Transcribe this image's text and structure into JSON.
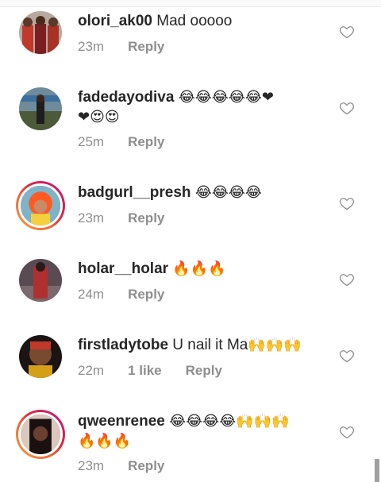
{
  "comments": [
    {
      "username": "olori_ak00",
      "text": " Mad ooooo",
      "emoji": "",
      "emoji2": "",
      "time": "23m",
      "likes": "",
      "reply": "Reply"
    },
    {
      "username": "fadedayodiva",
      "text": " ",
      "emoji": "😂😂😂😂😂❤",
      "emoji2": "❤😍😍",
      "time": "25m",
      "likes": "",
      "reply": "Reply"
    },
    {
      "username": "badgurl__presh",
      "text": " ",
      "emoji": "😂😂😂😂",
      "emoji2": "",
      "time": "23m",
      "likes": "",
      "reply": "Reply"
    },
    {
      "username": "holar__holar",
      "text": " ",
      "emoji": "🔥🔥🔥",
      "emoji2": "",
      "time": "24m",
      "likes": "",
      "reply": "Reply"
    },
    {
      "username": "firstladytobe",
      "text": " U nail it Ma",
      "emoji": "🙌🙌🙌",
      "emoji2": "",
      "time": "22m",
      "likes": "1 like",
      "reply": "Reply"
    },
    {
      "username": "qweenrenee",
      "text": " ",
      "emoji": "😂😂😂😂🙌🙌🙌",
      "emoji2": "🔥🔥🔥",
      "time": "23m",
      "likes": "",
      "reply": "Reply"
    }
  ],
  "icons": {
    "like": "heart-outline-icon"
  },
  "colors": {
    "username": "#262626",
    "meta": "#8e8e8e",
    "story_ring": "#dc2743"
  }
}
